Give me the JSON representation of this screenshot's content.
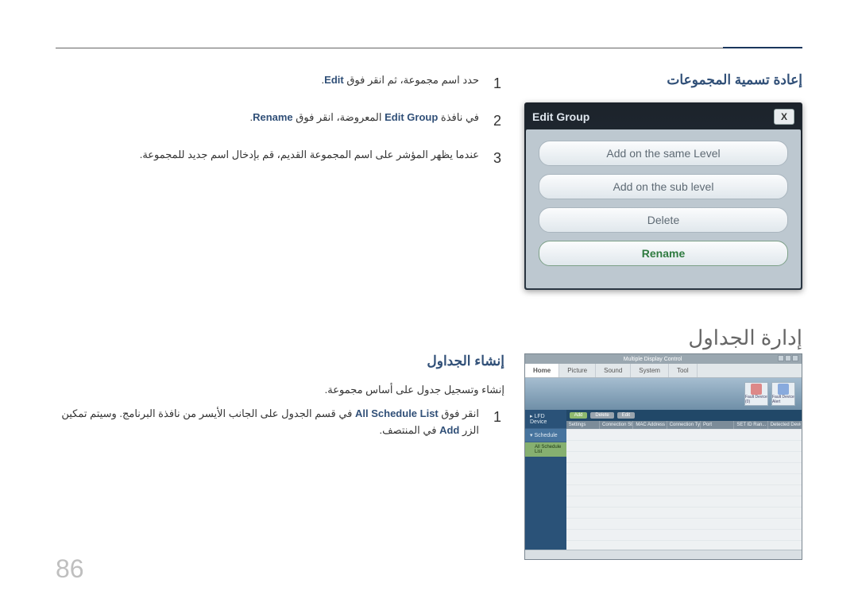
{
  "page_number": "86",
  "section1": {
    "title": "إعادة تسمية المجموعات",
    "steps": [
      {
        "num": "1",
        "pre": "حدد اسم مجموعة، ثم انقر فوق ",
        "hl": "Edit",
        "post": "."
      },
      {
        "num": "2",
        "pre": "في نافذة ",
        "hl1": "Edit Group",
        "mid": " المعروضة، انقر فوق ",
        "hl2": "Rename",
        "post": "."
      },
      {
        "num": "3",
        "text": "عندما يظهر المؤشر على اسم المجموعة القديم، قم بإدخال اسم جديد للمجموعة."
      }
    ],
    "dialog": {
      "title": "Edit Group",
      "close": "X",
      "options": [
        "Add on the same Level",
        "Add on the sub level",
        "Delete",
        "Rename"
      ],
      "selected_index": 3
    }
  },
  "section2": {
    "main_title": "إدارة الجداول",
    "sub_title": "إنشاء الجداول",
    "desc": "إنشاء وتسجيل جدول على أساس مجموعة.",
    "step_num": "1",
    "step_pre": "انقر فوق ",
    "step_hl1": "All Schedule List",
    "step_mid": " في قسم الجدول على الجانب الأيسر من نافذة البرنامج. وسيتم تمكين الزر ",
    "step_hl2": "Add",
    "step_post": " في المنتصف."
  },
  "mdc": {
    "title": "Multiple Display Control",
    "tabs": [
      "Home",
      "Picture",
      "Sound",
      "System",
      "Tool"
    ],
    "toolbar_icons": [
      {
        "label": "Fault Device (0)"
      },
      {
        "label": "Fault Device Alert"
      }
    ],
    "sidebar": {
      "items": [
        "LFD Device",
        "Schedule"
      ],
      "sub": "All Schedule List"
    },
    "topbar_buttons": [
      "Add",
      "Delete",
      "Edit"
    ],
    "columns": [
      "Settings",
      "Connection Status",
      "MAC Address",
      "Connection Type",
      "Port",
      "SET ID Ran...",
      "Detected Devices"
    ]
  }
}
